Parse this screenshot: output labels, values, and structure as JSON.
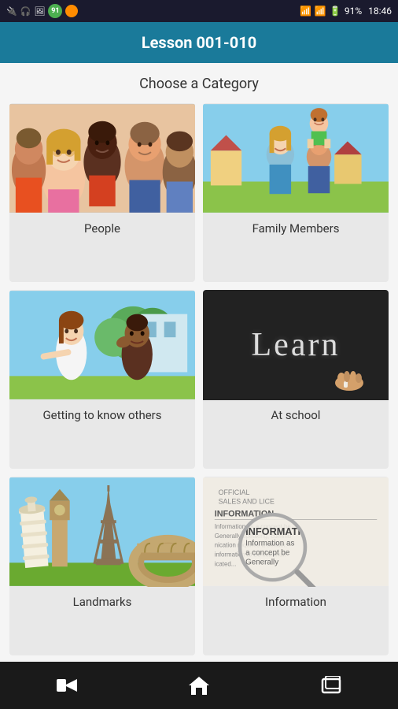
{
  "statusBar": {
    "time": "18:46",
    "battery": "91%",
    "icons": [
      "usb",
      "headphone",
      "image",
      "circle-91",
      "orange-circle"
    ]
  },
  "header": {
    "title": "Lesson 001-010"
  },
  "mainContent": {
    "subtitle": "Choose a Category",
    "categories": [
      {
        "id": "people",
        "label": "People",
        "imageType": "people"
      },
      {
        "id": "family-members",
        "label": "Family Members",
        "imageType": "family"
      },
      {
        "id": "getting-to-know",
        "label": "Getting to know others",
        "imageType": "getting"
      },
      {
        "id": "at-school",
        "label": "At school",
        "imageType": "school"
      },
      {
        "id": "landmarks",
        "label": "Landmarks",
        "imageType": "landmarks"
      },
      {
        "id": "information",
        "label": "Information",
        "imageType": "information"
      }
    ]
  },
  "bottomNav": {
    "back": "←",
    "home": "⌂",
    "recent": "▭"
  }
}
